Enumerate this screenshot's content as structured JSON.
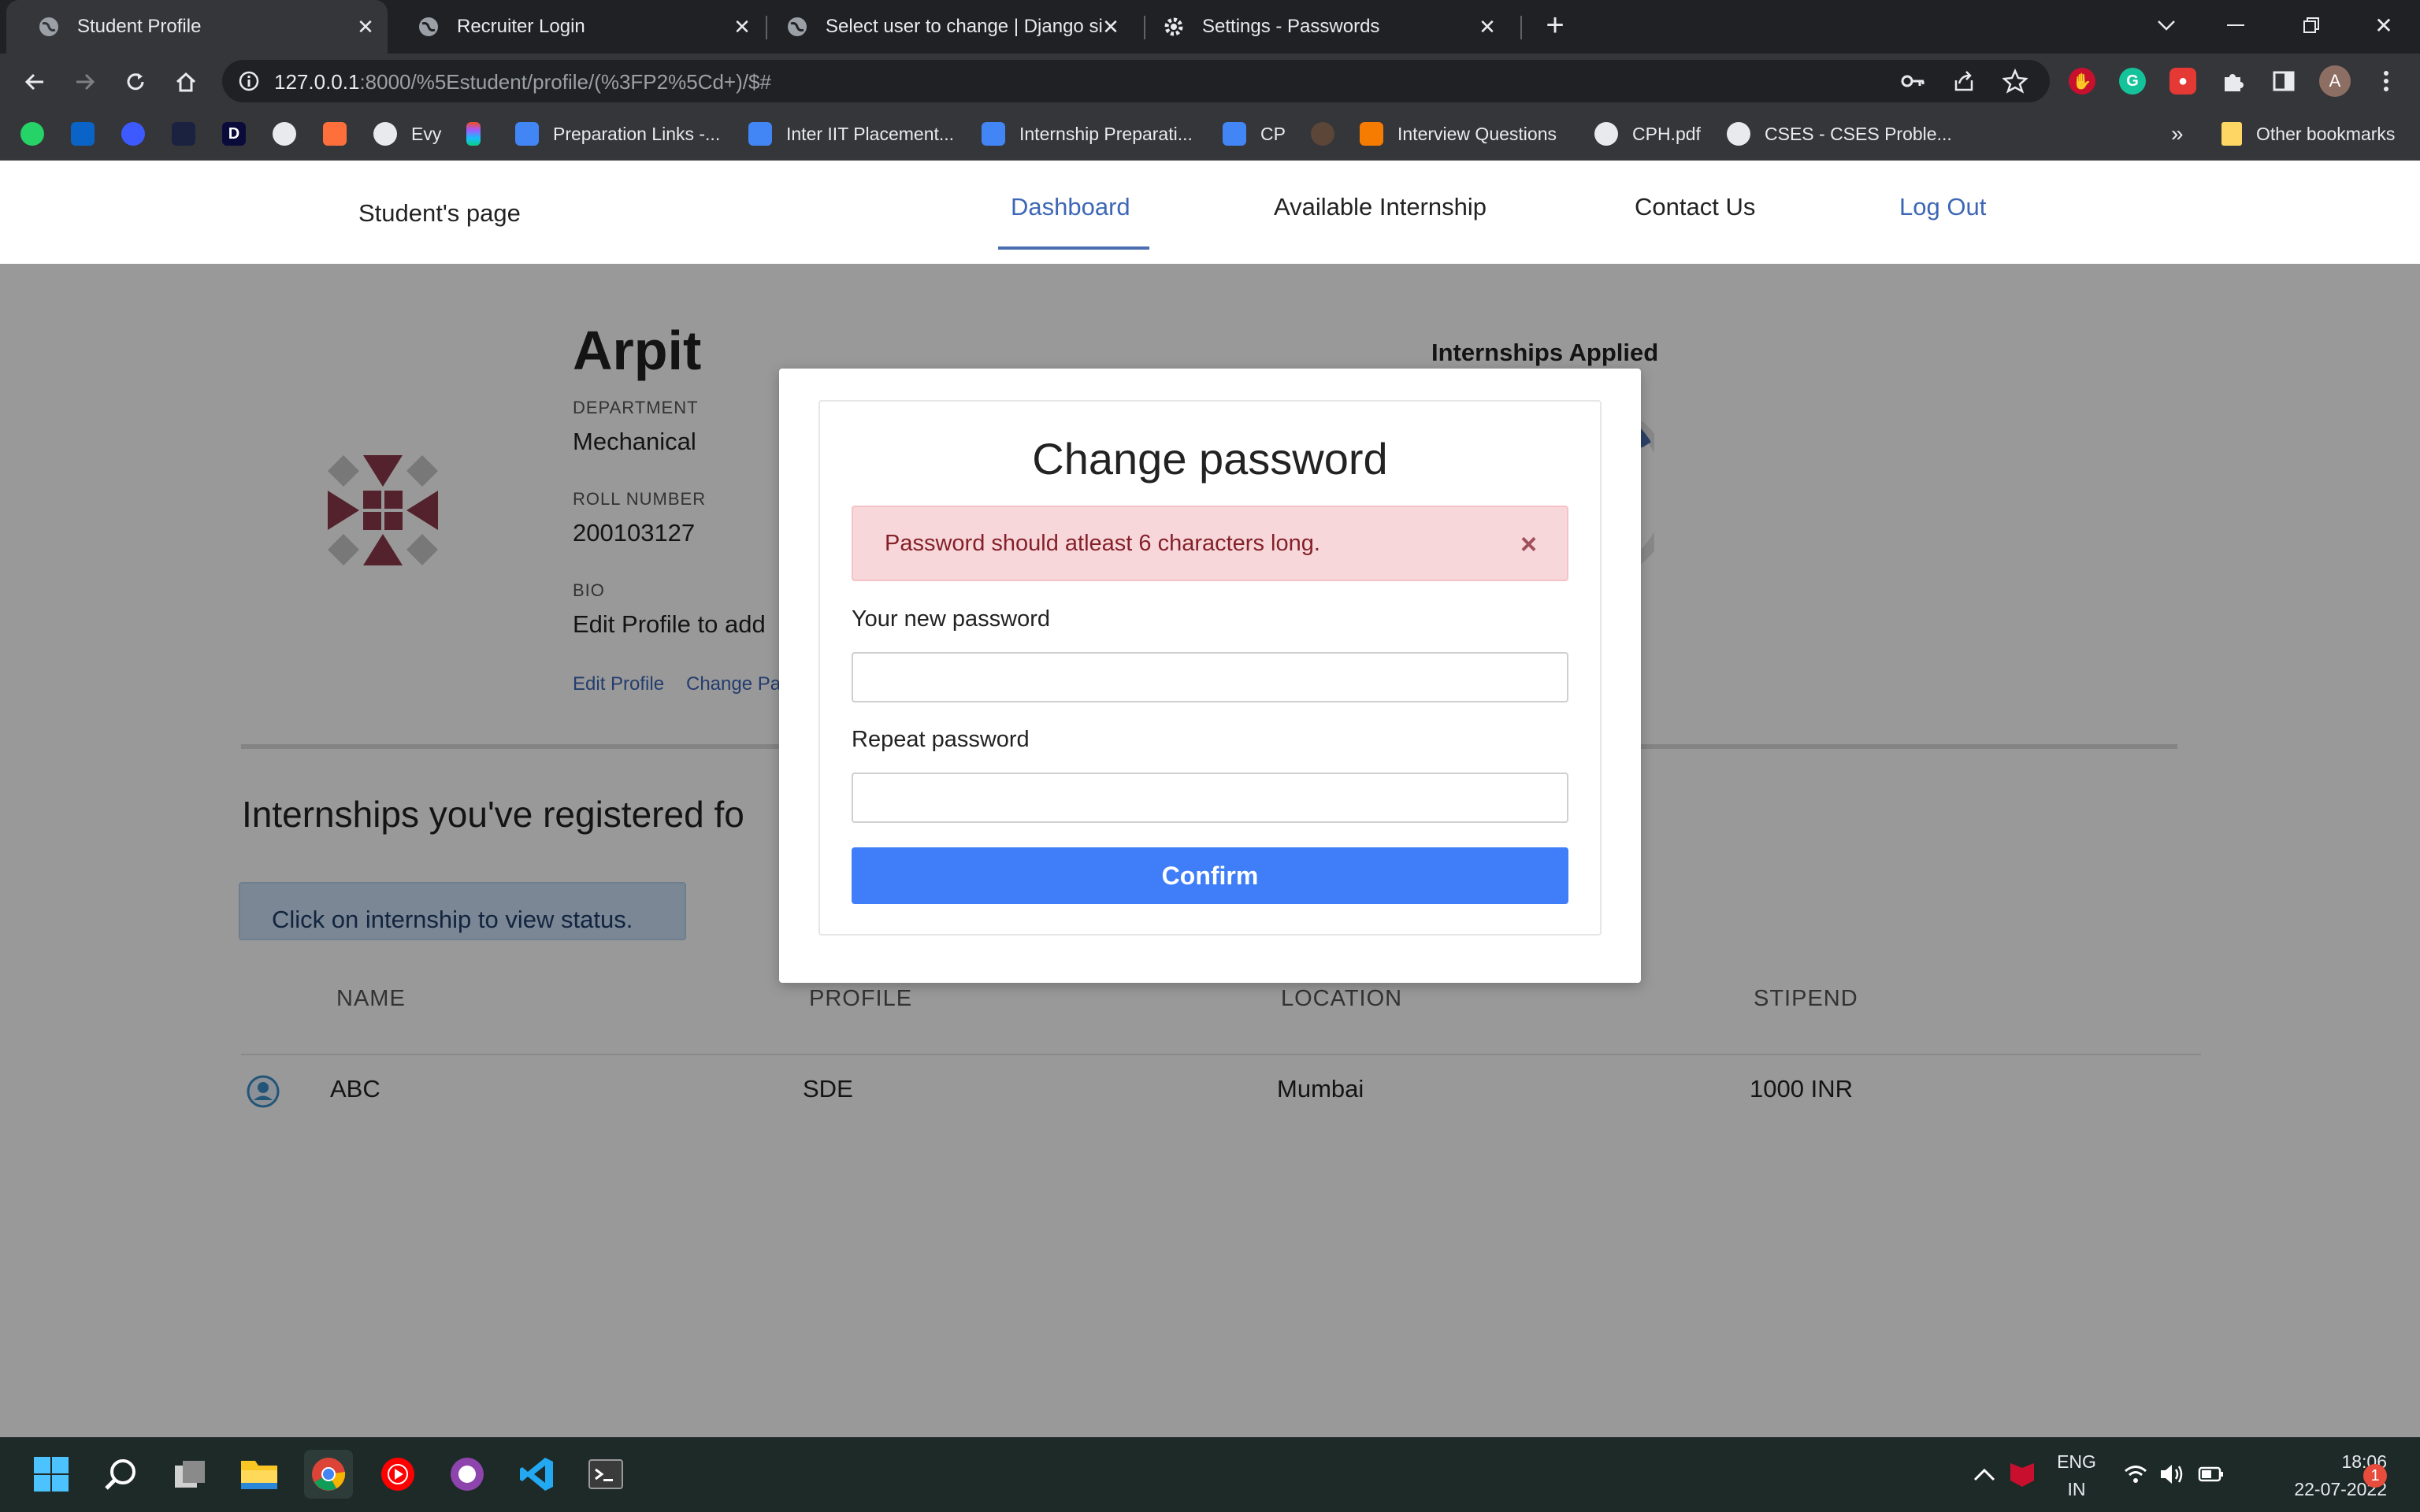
{
  "browser": {
    "tabs": [
      {
        "title": "Student Profile"
      },
      {
        "title": "Recruiter Login"
      },
      {
        "title": "Select user to change | Django si"
      },
      {
        "title": "Settings - Passwords"
      }
    ],
    "url_host": "127.0.0.1",
    "url_path": ":8000/%5Estudent/profile/(%3FP2%5Cd+)/$#",
    "profile_initial": "A",
    "bookmarks": [
      {
        "label": "Evy"
      },
      {
        "label": "Preparation Links -..."
      },
      {
        "label": "Inter IIT Placement..."
      },
      {
        "label": "Internship Preparati..."
      },
      {
        "label": "CP"
      },
      {
        "label": "Interview Questions"
      },
      {
        "label": "CPH.pdf"
      },
      {
        "label": "CSES - CSES Proble..."
      }
    ],
    "bookmarks_overflow": "»",
    "other_bookmarks": "Other bookmarks"
  },
  "nav": {
    "brand": "Student's page",
    "links": [
      "Dashboard",
      "Available Internship",
      "Contact Us",
      "Log Out"
    ]
  },
  "profile": {
    "name": "Arpit",
    "department_label": "DEPARTMENT",
    "department": "Mechanical",
    "roll_label": "ROLL NUMBER",
    "roll": "200103127",
    "bio_label": "BIO",
    "bio": "Edit Profile to add",
    "edit_link": "Edit Profile",
    "change_link": "Change Pa",
    "applied_title": "Internships Applied"
  },
  "internships": {
    "heading": "Internships you've registered fo",
    "note": "Click on internship to view status.",
    "columns": [
      "NAME",
      "PROFILE",
      "LOCATION",
      "STIPEND"
    ],
    "rows": [
      {
        "name": "ABC",
        "profile": "SDE",
        "location": "Mumbai",
        "stipend": "1000 INR"
      }
    ]
  },
  "modal": {
    "title": "Change password",
    "alert": "Password should atleast 6 characters long.",
    "alert_close": "×",
    "new_password_label": "Your new password",
    "repeat_password_label": "Repeat password",
    "confirm": "Confirm"
  },
  "taskbar": {
    "lang_top": "ENG",
    "lang_bottom": "IN",
    "time": "18:06",
    "date": "22-07-2022",
    "notification_count": "1"
  },
  "colors": {
    "accent": "#3f7ef8",
    "nav_link": "#3d67b6",
    "alert_bg": "#f8d7da",
    "alert_text": "#842029"
  }
}
